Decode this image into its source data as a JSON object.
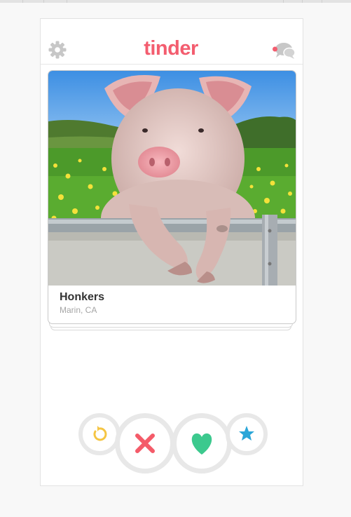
{
  "app": {
    "logo_text": "tinder",
    "accent_color": "#f35d6f"
  },
  "header": {
    "settings_icon": "gear-icon",
    "messages_icon": "chat-bubbles-icon"
  },
  "card": {
    "name": "Honkers",
    "location": "Marin, CA",
    "photo_subject": "pig-looking-over-fence"
  },
  "actions": [
    {
      "icon": "undo-icon",
      "color": "#f5c543"
    },
    {
      "icon": "x-icon",
      "color": "#f45b69"
    },
    {
      "icon": "heart-icon",
      "color": "#3cc98e"
    },
    {
      "icon": "star-icon",
      "color": "#2aa6d8"
    }
  ]
}
